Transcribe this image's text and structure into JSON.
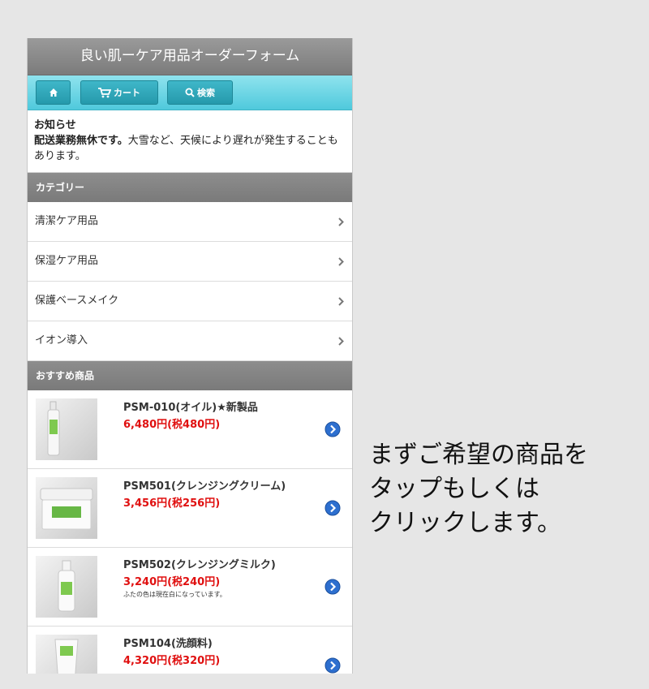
{
  "app": {
    "title": "良い肌ーケア用品オーダーフォーム"
  },
  "nav": {
    "home_icon": "home-icon",
    "cart_label": "カート",
    "search_label": "検索"
  },
  "notice": {
    "title": "お知らせ",
    "strong": "配送業務無休です。",
    "text": "大雪など、天候により遅れが発生することもあります。"
  },
  "categories": {
    "header": "カテゴリー",
    "items": [
      {
        "label": "清潔ケア用品"
      },
      {
        "label": "保湿ケア用品"
      },
      {
        "label": "保護ベースメイク"
      },
      {
        "label": "イオン導入"
      }
    ]
  },
  "recommended": {
    "header": "おすすめ商品",
    "products": [
      {
        "name": "PSM-010(オイル)★新製品",
        "price": "6,480円(税480円)",
        "note": ""
      },
      {
        "name": "PSM501(クレンジングクリーム)",
        "price": "3,456円(税256円)",
        "note": ""
      },
      {
        "name": "PSM502(クレンジングミルク)",
        "price": "3,240円(税240円)",
        "note": "ふたの色は現在白になっています。"
      },
      {
        "name": "PSM104(洗顔料)",
        "price": "4,320円(税320円)",
        "note": ""
      }
    ]
  },
  "instruction": {
    "line1": "まずご希望の商品を",
    "line2": "タップもしくは",
    "line3": "クリックします。"
  },
  "colors": {
    "accent": "#4fc9dc",
    "price": "#e01010",
    "header_gray": "#808080",
    "arrow_blue": "#2d6fcf"
  }
}
